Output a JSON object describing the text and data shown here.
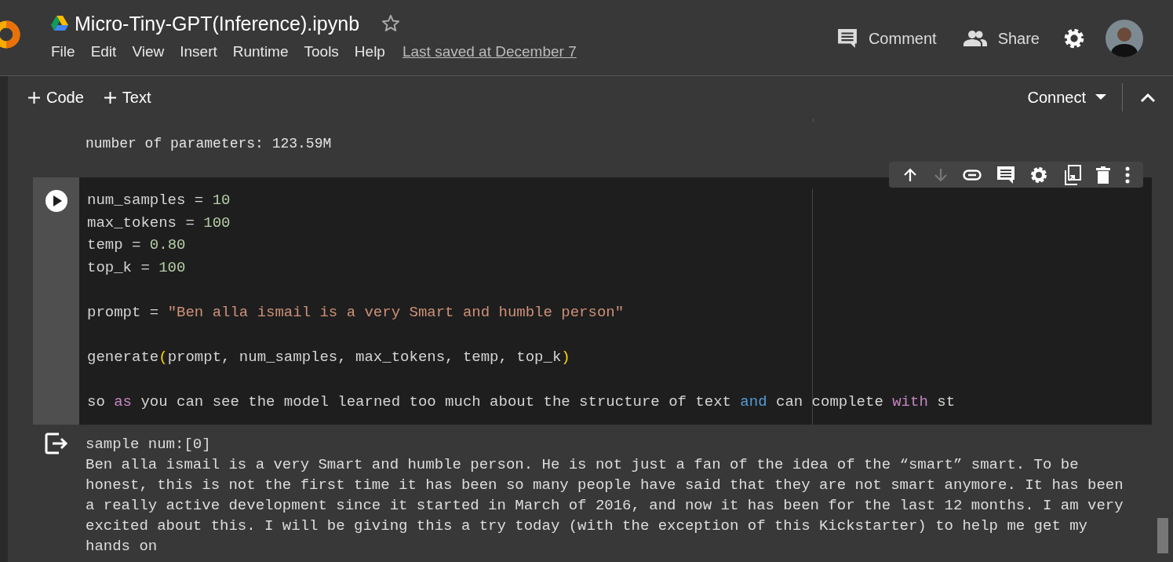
{
  "header": {
    "title": "Micro-Tiny-GPT(Inference).ipynb",
    "starred": false,
    "menu": [
      "File",
      "Edit",
      "View",
      "Insert",
      "Runtime",
      "Tools",
      "Help"
    ],
    "last_saved": "Last saved at December 7",
    "actions": [
      "Comment",
      "Share"
    ]
  },
  "toolbar": {
    "add_buttons": [
      "Code",
      "Text"
    ],
    "connect": "Connect"
  },
  "previous_output": "number of parameters: 123.59M",
  "cell": {
    "code_lines": [
      {
        "kind": "code",
        "tokens": [
          {
            "text": "num_samples = ",
            "kind": "plain"
          },
          {
            "text": "10",
            "kind": "number"
          }
        ]
      },
      {
        "kind": "code",
        "tokens": [
          {
            "text": "max_tokens = ",
            "kind": "plain"
          },
          {
            "text": "100",
            "kind": "number"
          }
        ]
      },
      {
        "kind": "code",
        "tokens": [
          {
            "text": "temp = ",
            "kind": "plain"
          },
          {
            "text": "0.80",
            "kind": "number"
          }
        ]
      },
      {
        "kind": "code",
        "tokens": [
          {
            "text": "top_k = ",
            "kind": "plain"
          },
          {
            "text": "100",
            "kind": "number"
          }
        ]
      },
      {
        "kind": "blank"
      },
      {
        "kind": "code",
        "tokens": [
          {
            "text": "prompt = ",
            "kind": "plain"
          },
          {
            "text": "\"Ben alla ismail is a very Smart and humble person\"",
            "kind": "string"
          }
        ]
      },
      {
        "kind": "blank"
      },
      {
        "kind": "code",
        "tokens": [
          {
            "text": "generate",
            "kind": "plain"
          },
          {
            "text": "(",
            "kind": "bracket"
          },
          {
            "text": "prompt, num_samples, max_tokens, temp, top_k",
            "kind": "plain"
          },
          {
            "text": ")",
            "kind": "bracket"
          }
        ]
      },
      {
        "kind": "blank"
      },
      {
        "kind": "code",
        "tokens": [
          {
            "text": "so ",
            "kind": "plain"
          },
          {
            "text": "as",
            "kind": "keyword"
          },
          {
            "text": " you can see the model learned too much about the structure of text ",
            "kind": "plain"
          },
          {
            "text": "and",
            "kind": "operator"
          },
          {
            "text": " can complete ",
            "kind": "plain"
          },
          {
            "text": "with",
            "kind": "keyword"
          },
          {
            "text": " st",
            "kind": "plain"
          }
        ]
      }
    ],
    "output_lines": [
      "sample num:[0]",
      "Ben alla ismail is a very Smart and humble person. He is not just a fan of the idea of the “smart” smart. To be",
      "honest, this is not the first time it has been so many people have said that they are not smart anymore. It has been",
      "a really active development since it started in March of 2016, and now it has been for the last 12 months. I am very",
      "excited about this. I will be giving this a try today (with the exception of this Kickstarter) to help me get my",
      "hands on"
    ]
  }
}
